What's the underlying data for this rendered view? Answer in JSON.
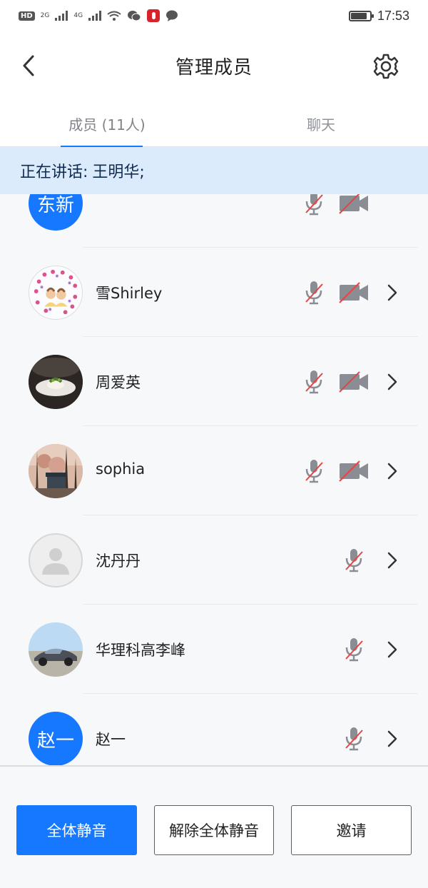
{
  "status_bar": {
    "hd_badge": "HD",
    "net_2g": "2G",
    "net_4g": "4G",
    "time": "17:53",
    "battery_level": 0.85
  },
  "header": {
    "title": "管理成员",
    "back_icon": "chevron-left-icon",
    "settings_icon": "gear-icon"
  },
  "tabs": [
    {
      "label": "成员 (11人)",
      "active": true
    },
    {
      "label": "聊天",
      "active": false
    }
  ],
  "speaking": {
    "prefix": "正在讲话:",
    "speaker": "王明华;"
  },
  "members": [
    {
      "name": "",
      "avatar_text": "东新",
      "avatar_type": "text",
      "mic_muted": true,
      "camera_off": true
    },
    {
      "name": "雪Shirley",
      "avatar_type": "photo-hearts",
      "mic_muted": true,
      "camera_off": true
    },
    {
      "name": "周爱英",
      "avatar_type": "photo-dish",
      "mic_muted": true,
      "camera_off": true
    },
    {
      "name": "sophia",
      "avatar_type": "photo-trees",
      "mic_muted": true,
      "camera_off": true
    },
    {
      "name": "沈丹丹",
      "avatar_type": "placeholder",
      "mic_muted": true,
      "camera_off": null
    },
    {
      "name": "华理科高李峰",
      "avatar_type": "photo-car",
      "mic_muted": true,
      "camera_off": null
    },
    {
      "name": "赵一",
      "avatar_text": "赵一",
      "avatar_type": "text",
      "mic_muted": true,
      "camera_off": null
    }
  ],
  "bottom_buttons": {
    "mute_all": "全体静音",
    "unmute_all": "解除全体静音",
    "invite": "邀请"
  },
  "colors": {
    "accent": "#1677ff",
    "banner_bg": "#dcebfb",
    "muted_red": "#e64545",
    "icon_gray": "#8a8d93"
  }
}
